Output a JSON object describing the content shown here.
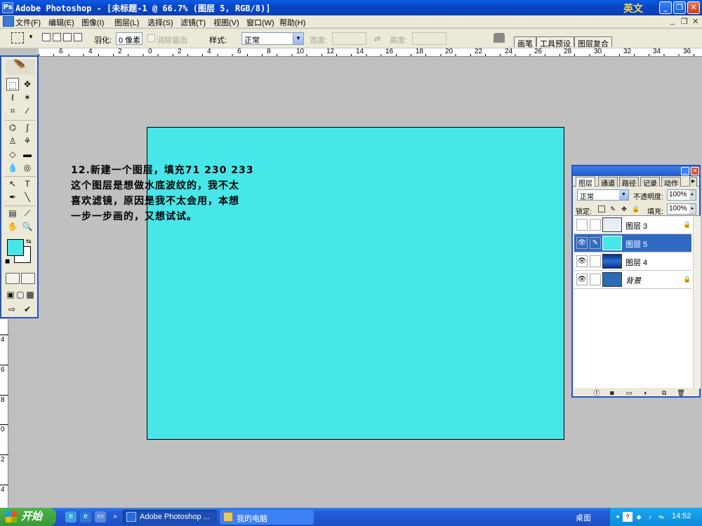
{
  "window": {
    "title": "Adobe Photoshop - [未标题-1 @ 66.7% (图层 5, RGB/8)]",
    "ime_indicator": "英文",
    "controls": {
      "minimize": "_",
      "restore": "❐",
      "close": "✕"
    }
  },
  "menubar": {
    "items": [
      "文件(F)",
      "编辑(E)",
      "图像(I)",
      "图层(L)",
      "选择(S)",
      "滤镜(T)",
      "视图(V)",
      "窗口(W)",
      "帮助(H)"
    ],
    "mdi_controls": [
      "_",
      "❐",
      "✕"
    ]
  },
  "options_bar": {
    "feather_label": "羽化:",
    "feather_value": "0 像素",
    "antialias_label": "消除锯齿",
    "style_label": "样式:",
    "style_value": "正常",
    "width_label": "宽度:",
    "height_label": "高度:",
    "palette_well_tabs": [
      "画笔",
      "工具预设",
      "图层复合"
    ]
  },
  "ruler": {
    "top_labels": [
      "6",
      "4",
      "2",
      "0",
      "2",
      "4",
      "6",
      "8",
      "10",
      "12",
      "14",
      "16",
      "18",
      "20",
      "22",
      "24",
      "26",
      "28",
      "30",
      "32",
      "34",
      "36"
    ],
    "left_labels": [
      "4",
      "6",
      "8",
      "0",
      "2",
      "4"
    ]
  },
  "canvas": {
    "fill_color": "#47e6e9",
    "background": "#c0c0c0"
  },
  "tutorial_text": {
    "lines": [
      "12.新建一个图层，填充71 230 233",
      "这个图层是想做水底波纹的，我不太",
      "喜欢滤镜，原因是我不太会用，本想",
      "一步一步画的，又想试试。"
    ]
  },
  "toolbox": {
    "foreground_color": "#47e6e9",
    "background_color": "#ffffff"
  },
  "layers_panel": {
    "tabs": [
      "图层",
      "通道",
      "路径",
      "记录",
      "动作"
    ],
    "blend_mode": "正常",
    "opacity_label": "不透明度:",
    "opacity_value": "100%",
    "lock_label": "锁定:",
    "fill_label": "填充:",
    "fill_value": "100%",
    "layers": [
      {
        "name": "图层 3",
        "visible": false,
        "selected": false,
        "locked": true
      },
      {
        "name": "图层 5",
        "visible": true,
        "selected": true,
        "locked": false
      },
      {
        "name": "图层 4",
        "visible": true,
        "selected": false,
        "locked": false
      },
      {
        "name": "背景",
        "visible": true,
        "selected": false,
        "locked": true
      }
    ]
  },
  "taskbar": {
    "start_label": "开始",
    "tasks": [
      "Adobe Photoshop ...",
      "我的电脑"
    ],
    "desktop_label": "桌面",
    "clock": "14:52"
  }
}
